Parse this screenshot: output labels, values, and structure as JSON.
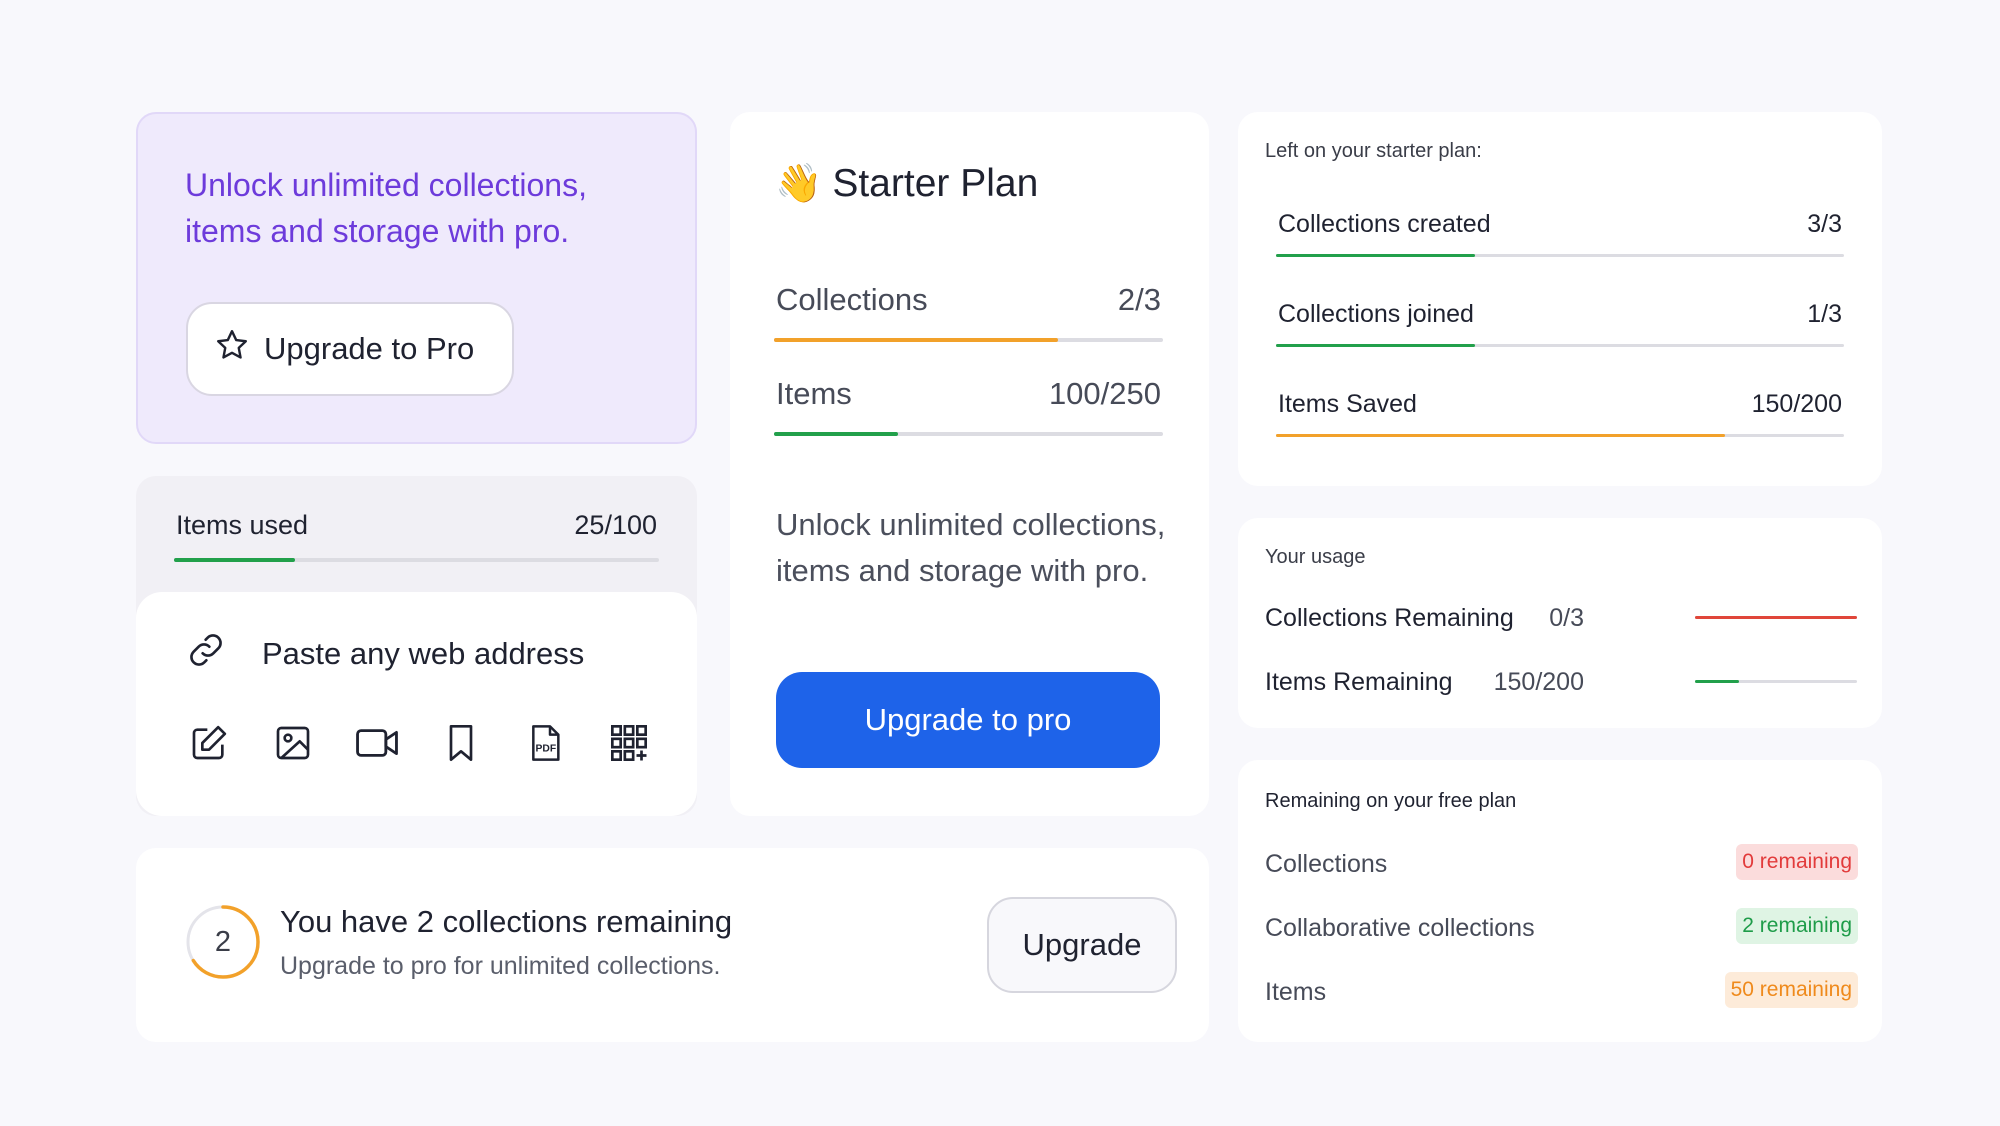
{
  "promo": {
    "text": "Unlock unlimited collections, items and storage with pro.",
    "button_label": "Upgrade to Pro"
  },
  "items_used": {
    "label": "Items used",
    "value": "25/100",
    "progress": 0.25,
    "color": "#22a04b"
  },
  "paste": {
    "label": "Paste any web address",
    "tools": [
      "edit-icon",
      "image-icon",
      "video-icon",
      "bookmark-icon",
      "pdf-icon",
      "grid-add-icon"
    ],
    "pdf_text": "PDF"
  },
  "starter": {
    "emoji": "👋",
    "title": "Starter Plan",
    "stats": [
      {
        "label": "Collections",
        "value": "2/3",
        "progress": 0.73,
        "color": "#f2a12a"
      },
      {
        "label": "Items",
        "value": "100/250",
        "progress": 0.32,
        "color": "#22a04b"
      }
    ],
    "description": "Unlock unlimited collections, items and storage with pro.",
    "button_label": "Upgrade to pro",
    "accent": "#1e63e9"
  },
  "left_starter": {
    "label": "Left on your starter plan:",
    "rows": [
      {
        "label": "Collections created",
        "value": "3/3",
        "progress": 0.35,
        "color": "#22a04b"
      },
      {
        "label": "Collections joined",
        "value": "1/3",
        "progress": 0.35,
        "color": "#22a04b"
      },
      {
        "label": "Items Saved",
        "value": "150/200",
        "progress": 0.79,
        "color": "#f2a12a"
      }
    ]
  },
  "usage": {
    "label": "Your usage",
    "rows": [
      {
        "label": "Collections Remaining",
        "value": "0/3",
        "progress": 1.0,
        "color": "#e0463a"
      },
      {
        "label": "Items Remaining",
        "value": "150/200",
        "progress": 0.27,
        "color": "#22a04b"
      }
    ]
  },
  "free": {
    "label": "Remaining on your free plan",
    "rows": [
      {
        "label": "Collections",
        "badge": "0 remaining",
        "bg": "#fbdcdc",
        "fg": "#e23b3b"
      },
      {
        "label": "Collaborative collections",
        "badge": "2 remaining",
        "bg": "#dff4e4",
        "fg": "#1e9c49"
      },
      {
        "label": "Items",
        "badge": "50 remaining",
        "bg": "#fdebd9",
        "fg": "#ef8a1c"
      }
    ]
  },
  "banner": {
    "count": "2",
    "ring_progress": 0.66,
    "ring_color": "#f2a12a",
    "title": "You have 2 collections remaining",
    "subtitle": "Upgrade to pro for unlimited collections.",
    "button_label": "Upgrade"
  }
}
